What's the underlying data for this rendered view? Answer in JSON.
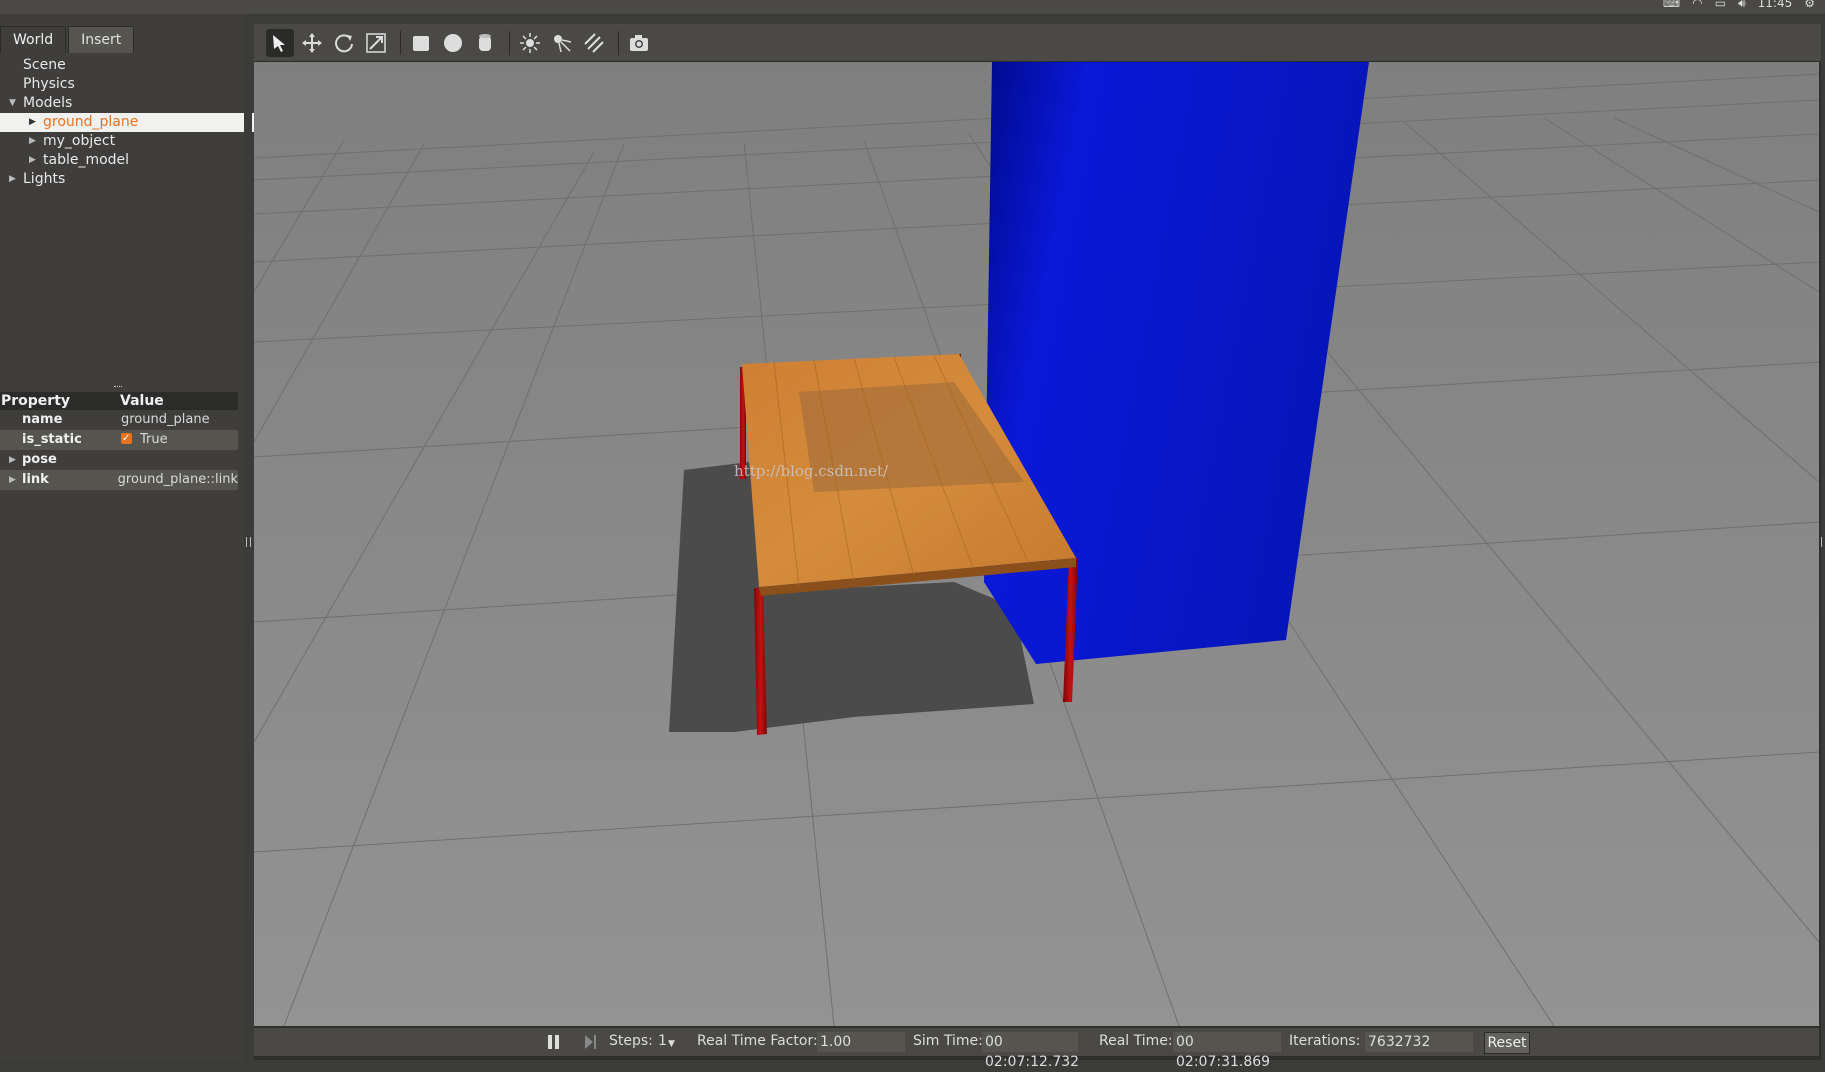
{
  "tray": {
    "time": "11:45"
  },
  "tabs": [
    {
      "label": "World",
      "active": true
    },
    {
      "label": "Insert",
      "active": false
    }
  ],
  "tree": {
    "scene": "Scene",
    "physics": "Physics",
    "models": "Models",
    "model_items": [
      "ground_plane",
      "my_object",
      "table_model"
    ],
    "selected": "ground_plane",
    "lights": "Lights"
  },
  "properties": {
    "header_property": "Property",
    "header_value": "Value",
    "rows": [
      {
        "key": "name",
        "value": "ground_plane"
      },
      {
        "key": "is_static",
        "value": "True"
      },
      {
        "key": "pose",
        "value": ""
      },
      {
        "key": "link",
        "value": "ground_plane::link"
      }
    ]
  },
  "toolbar": {
    "tools": [
      "select-tool",
      "translate-tool",
      "rotate-tool",
      "scale-tool",
      "box-shape",
      "sphere-shape",
      "cylinder-shape",
      "point-light",
      "spot-light",
      "directional-light",
      "screenshot-tool"
    ]
  },
  "scene": {
    "watermark": "http://blog.csdn.net/",
    "colors": {
      "ground": "#8a8a8a",
      "box": "#0a1ad6",
      "table_top": "#c8782e",
      "table_legs": "#b50e0e",
      "shadow": "#4b4b4b"
    }
  },
  "status": {
    "steps_label": "Steps:",
    "steps_value": "1",
    "rtf_label": "Real Time Factor:",
    "rtf_value": "1.00",
    "sim_label": "Sim Time:",
    "sim_value": "00 02:07:12.732",
    "real_label": "Real Time:",
    "real_value": "00 02:07:31.869",
    "iter_label": "Iterations:",
    "iter_value": "7632732",
    "reset_label": "Reset"
  }
}
